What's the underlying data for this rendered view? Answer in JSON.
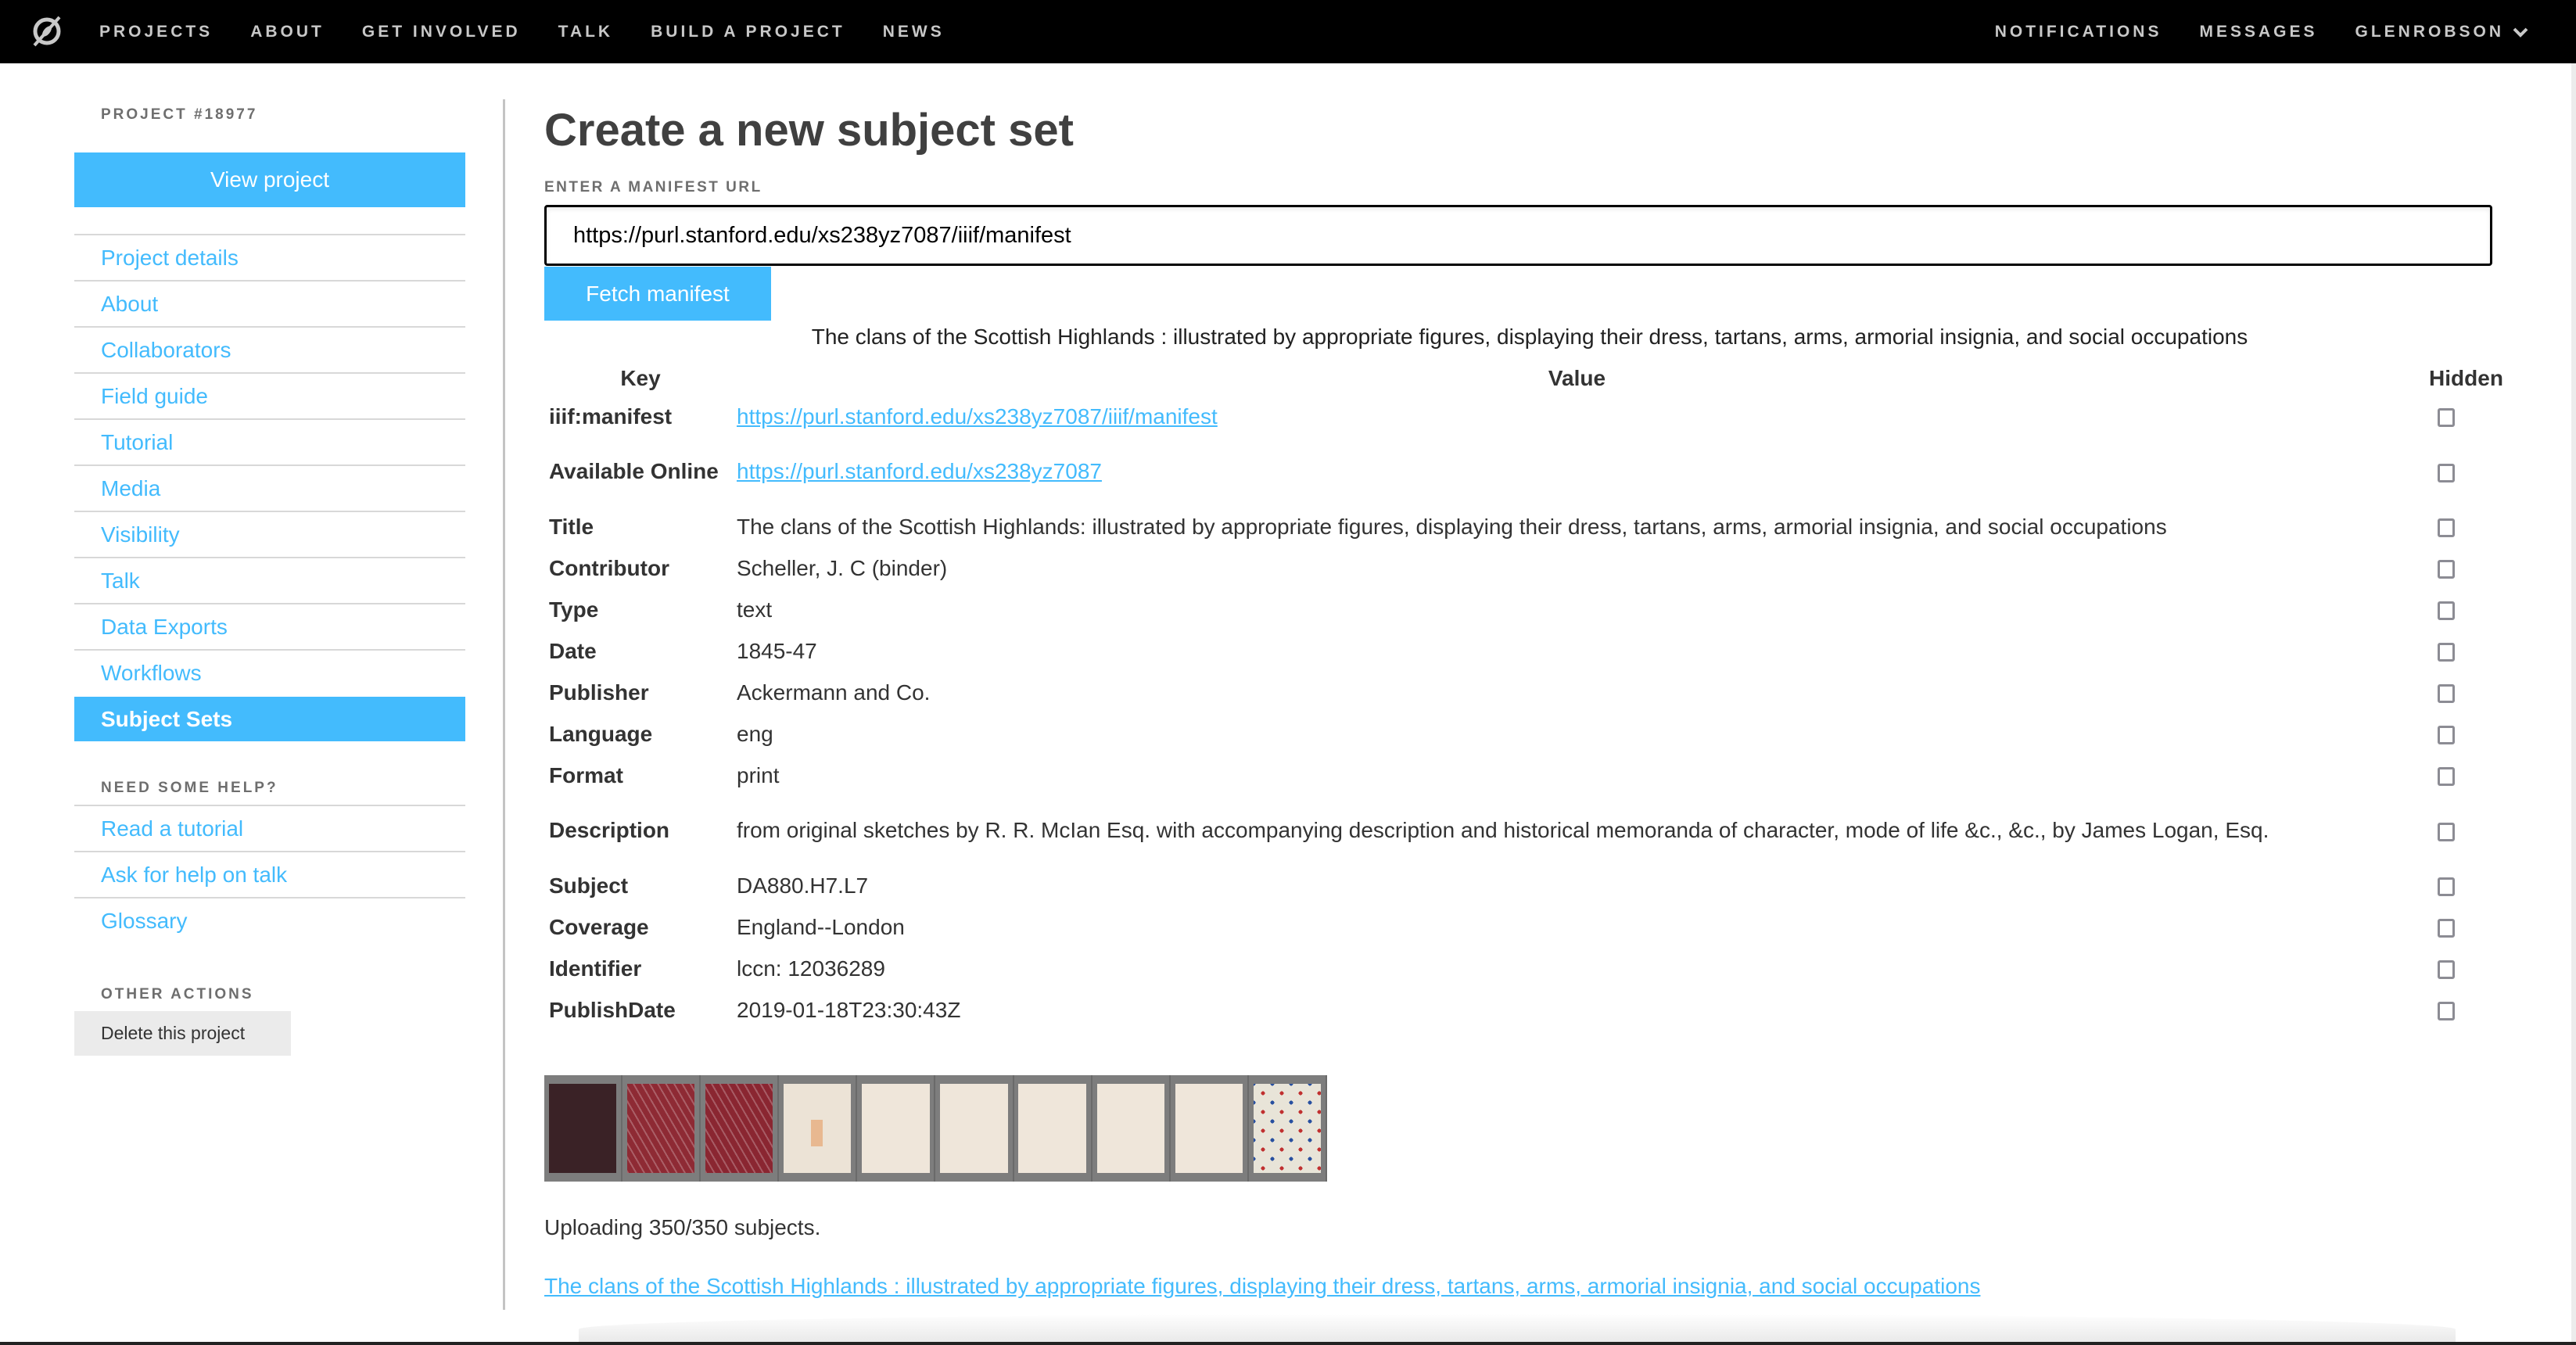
{
  "nav": {
    "logo": "zooniverse-logo",
    "left": [
      "PROJECTS",
      "ABOUT",
      "GET INVOLVED",
      "TALK",
      "BUILD A PROJECT",
      "NEWS"
    ],
    "right": [
      "NOTIFICATIONS",
      "MESSAGES",
      "GLENROBSON"
    ]
  },
  "sidebar": {
    "project_heading": "PROJECT #18977",
    "view_project": "View project",
    "items": [
      {
        "label": "Project details",
        "active": false
      },
      {
        "label": "About",
        "active": false
      },
      {
        "label": "Collaborators",
        "active": false
      },
      {
        "label": "Field guide",
        "active": false
      },
      {
        "label": "Tutorial",
        "active": false
      },
      {
        "label": "Media",
        "active": false
      },
      {
        "label": "Visibility",
        "active": false
      },
      {
        "label": "Talk",
        "active": false
      },
      {
        "label": "Data Exports",
        "active": false
      },
      {
        "label": "Workflows",
        "active": false
      },
      {
        "label": "Subject Sets",
        "active": true
      }
    ],
    "help_heading": "NEED SOME HELP?",
    "help_items": [
      "Read a tutorial",
      "Ask for help on talk",
      "Glossary"
    ],
    "other_heading": "OTHER ACTIONS",
    "delete_label": "Delete this project"
  },
  "main": {
    "title": "Create a new subject set",
    "manifest_label": "ENTER A MANIFEST URL",
    "manifest_url": "https://purl.stanford.edu/xs238yz7087/iiif/manifest",
    "fetch_label": "Fetch manifest",
    "manifest_title": "The clans of the Scottish Highlands : illustrated by appropriate figures, displaying their dress, tartans, arms, armorial insignia, and social occupations",
    "table": {
      "headers": {
        "key": "Key",
        "value": "Value",
        "hidden": "Hidden"
      },
      "rows": [
        {
          "key": "iiif:manifest",
          "value": "https://purl.stanford.edu/xs238yz7087/iiif/manifest",
          "link": true,
          "hidden": false
        },
        {
          "key": "Available Online",
          "value": "https://purl.stanford.edu/xs238yz7087",
          "link": true,
          "hidden": false
        },
        {
          "key": "Title",
          "value": "The clans of the Scottish Highlands: illustrated by appropriate figures, displaying their dress, tartans, arms, armorial insignia, and social occupations",
          "link": false,
          "hidden": false
        },
        {
          "key": "Contributor",
          "value": "Scheller, J. C (binder)",
          "link": false,
          "hidden": false
        },
        {
          "key": "Type",
          "value": "text",
          "link": false,
          "hidden": false
        },
        {
          "key": "Date",
          "value": "1845-47",
          "link": false,
          "hidden": false
        },
        {
          "key": "Publisher",
          "value": "Ackermann and Co.",
          "link": false,
          "hidden": false
        },
        {
          "key": "Language",
          "value": "eng",
          "link": false,
          "hidden": false
        },
        {
          "key": "Format",
          "value": "print",
          "link": false,
          "hidden": false
        },
        {
          "key": "Description",
          "value": "from original sketches by R. R. McIan Esq. with accompanying description and historical memoranda of character, mode of life &c., &c., by James Logan, Esq.",
          "link": false,
          "hidden": false
        },
        {
          "key": "Subject",
          "value": "DA880.H7.L7",
          "link": false,
          "hidden": false
        },
        {
          "key": "Coverage",
          "value": "England--London",
          "link": false,
          "hidden": false
        },
        {
          "key": "Identifier",
          "value": "lccn: 12036289",
          "link": false,
          "hidden": false
        },
        {
          "key": "PublishDate",
          "value": "2019-01-18T23:30:43Z",
          "link": false,
          "hidden": false
        }
      ]
    },
    "thumbnails": [
      {
        "name": "front-cover",
        "color": "#3a2226"
      },
      {
        "name": "marbled-endpaper",
        "color": "#8e2a34"
      },
      {
        "name": "marbled-endpaper",
        "color": "#8a2631"
      },
      {
        "name": "bookplate-page",
        "color": "#ece3d6"
      },
      {
        "name": "blank-page",
        "color": "#efe6da"
      },
      {
        "name": "blank-page",
        "color": "#efe6da"
      },
      {
        "name": "blank-page",
        "color": "#efe6da"
      },
      {
        "name": "blank-page",
        "color": "#efe6da"
      },
      {
        "name": "blank-page",
        "color": "#efe6da"
      },
      {
        "name": "heraldic-frontispiece",
        "color": "#6f8a5a"
      }
    ],
    "upload_status": "Uploading 350/350 subjects.",
    "result_link": "The clans of the Scottish Highlands : illustrated by appropriate figures, displaying their dress, tartans, arms, armorial insignia, and social occupations"
  },
  "colors": {
    "accent": "#43bbfd",
    "nav_bg": "#000000",
    "nav_text": "#c8c8c8",
    "text": "#404040"
  }
}
